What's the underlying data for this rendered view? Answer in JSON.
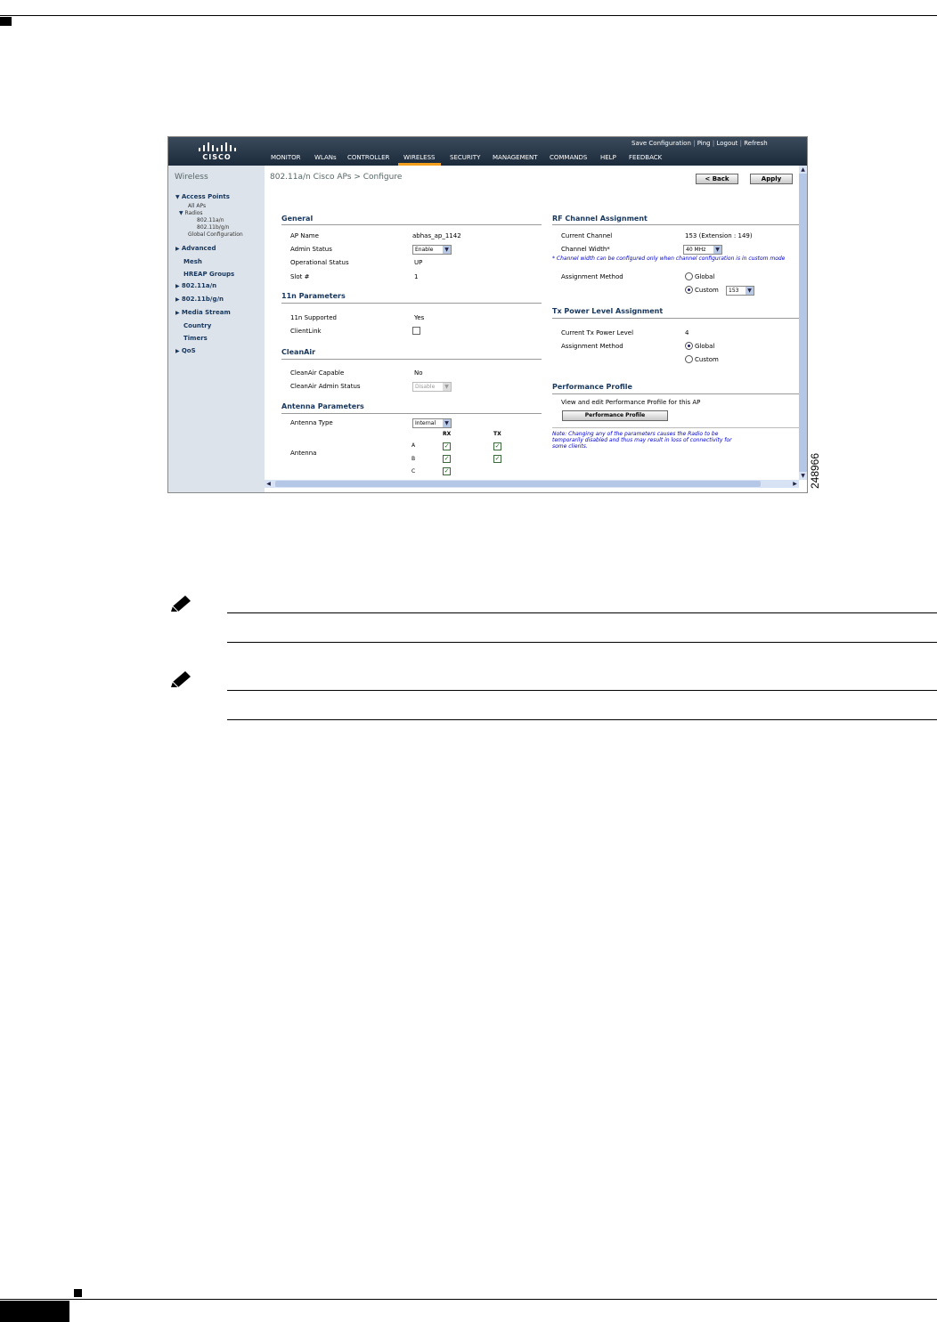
{
  "figure_number": "248966",
  "header": {
    "logo_text": "CISCO",
    "top_links": [
      "Save Configuration",
      "Ping",
      "Logout",
      "Refresh"
    ],
    "nav": [
      "MONITOR",
      "WLANs",
      "CONTROLLER",
      "WIRELESS",
      "SECURITY",
      "MANAGEMENT",
      "COMMANDS",
      "HELP",
      "FEEDBACK"
    ],
    "active_nav": "WIRELESS"
  },
  "sidebar": {
    "title": "Wireless",
    "access_points": "Access Points",
    "all_aps": "All APs",
    "radios": "Radios",
    "radio_a": "802.11a/n",
    "radio_bg": "802.11b/g/n",
    "global_config": "Global Configuration",
    "advanced": "Advanced",
    "mesh": "Mesh",
    "hreap": "HREAP Groups",
    "a_n": "802.11a/n",
    "bg_n": "802.11b/g/n",
    "media_stream": "Media Stream",
    "country": "Country",
    "timers": "Timers",
    "qos": "QoS"
  },
  "page": {
    "title": "802.11a/n Cisco APs > Configure",
    "back_label": "< Back",
    "apply_label": "Apply"
  },
  "general": {
    "heading": "General",
    "ap_name_label": "AP Name",
    "ap_name": "abhas_ap_1142",
    "admin_status_label": "Admin Status",
    "admin_status": "Enable",
    "op_status_label": "Operational Status",
    "op_status": "UP",
    "slot_label": "Slot #",
    "slot": "1"
  },
  "n11": {
    "heading": "11n Parameters",
    "supported_label": "11n Supported",
    "supported": "Yes",
    "clientlink_label": "ClientLink"
  },
  "cleanair": {
    "heading": "CleanAir",
    "capable_label": "CleanAir Capable",
    "capable": "No",
    "admin_label": "CleanAir Admin Status",
    "admin": "Disable"
  },
  "antenna": {
    "heading": "Antenna Parameters",
    "type_label": "Antenna Type",
    "type": "Internal",
    "antenna_label": "Antenna",
    "rx": "RX",
    "tx": "TX",
    "a": "A",
    "b": "B",
    "c": "C"
  },
  "rf": {
    "heading": "RF Channel Assignment",
    "current_label": "Current Channel",
    "current": "153 (Extension : 149)",
    "width_label": "Channel Width*",
    "width": "40 MHz",
    "note": "* Channel width can be configured only when channel configuration is in custom mode",
    "method_label": "Assignment Method",
    "global": "Global",
    "custom": "Custom",
    "custom_value": "153"
  },
  "tx": {
    "heading": "Tx Power Level Assignment",
    "current_label": "Current Tx Power Level",
    "current": "4",
    "method_label": "Assignment Method",
    "global": "Global",
    "custom": "Custom"
  },
  "perf": {
    "heading": "Performance Profile",
    "text": "View and edit Performance Profile for this AP",
    "button": "Performance Profile"
  },
  "bottom_note": [
    "Note: Changing any of the parameters causes the Radio to be",
    "temporarily disabled and thus may result in loss of connectivity for",
    "some clients."
  ]
}
